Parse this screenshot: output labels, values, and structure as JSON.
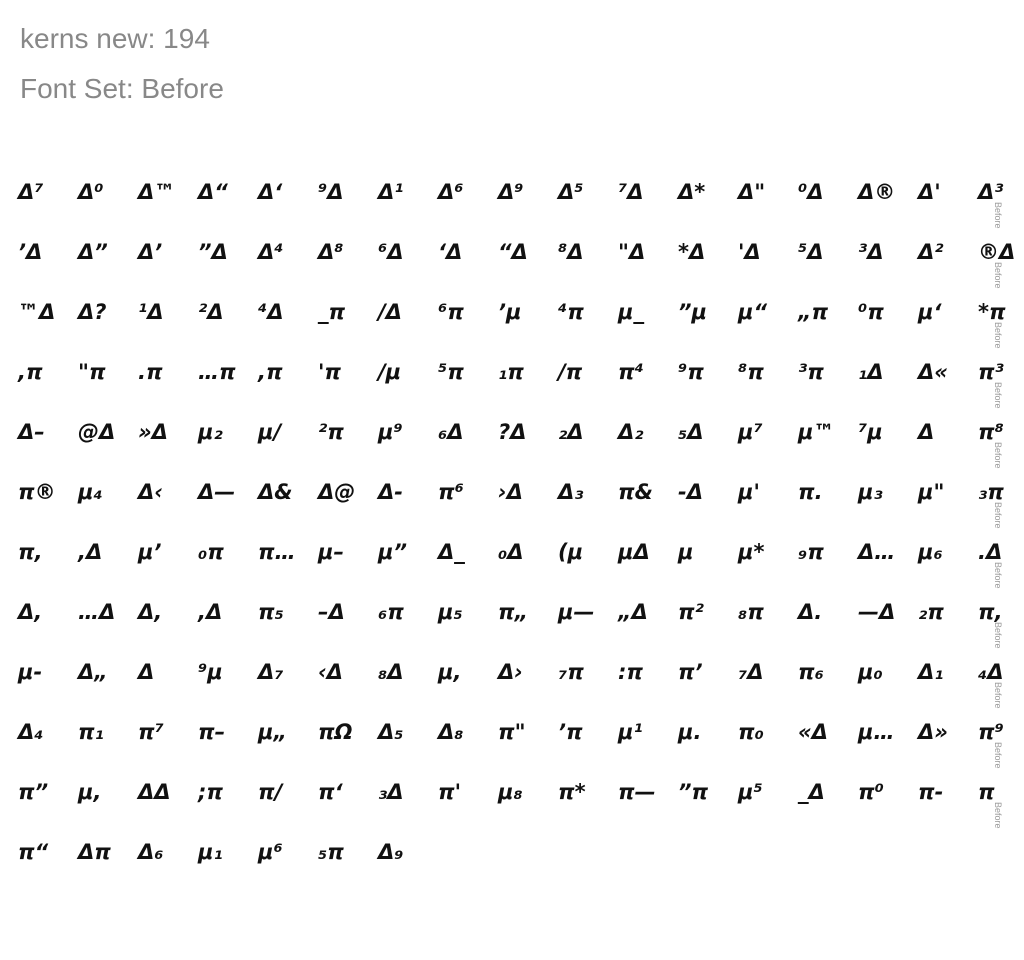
{
  "header": {
    "title": "kerns new: 194",
    "font_set": "Font Set: Before"
  },
  "row_label": "Before",
  "rows": [
    [
      "Δ⁷",
      "Δ⁰",
      "Δ™",
      "Δ“",
      "Δ‘",
      "⁹Δ",
      "Δ¹",
      "Δ⁶",
      "Δ⁹",
      "Δ⁵",
      "⁷Δ",
      "Δ*",
      "Δ\"",
      "⁰Δ",
      "Δ®",
      "Δ'",
      "Δ³"
    ],
    [
      "’Δ",
      "Δ”",
      "Δ’",
      "”Δ",
      "Δ⁴",
      "Δ⁸",
      "⁶Δ",
      "‘Δ",
      "“Δ",
      "⁸Δ",
      "\"Δ",
      "*Δ",
      "'Δ",
      "⁵Δ",
      "³Δ",
      "Δ²",
      "®Δ"
    ],
    [
      "™Δ",
      "Δ?",
      "¹Δ",
      "²Δ",
      "⁴Δ",
      "_π",
      "/Δ",
      "⁶π",
      "’μ",
      "⁴π",
      "μ_",
      "”μ",
      "μ“",
      "„π",
      "⁰π",
      "μ‘",
      "*π"
    ],
    [
      ",π",
      "\"π",
      ".π",
      "…π",
      ",π",
      "'π",
      "/μ",
      "⁵π",
      "₁π",
      "/π",
      "π⁴",
      "⁹π",
      "⁸π",
      "³π",
      "₁Δ",
      "Δ«",
      "π³"
    ],
    [
      "Δ–",
      "@Δ",
      "»Δ",
      "μ₂",
      "μ/",
      "²π",
      "μ⁹",
      "₆Δ",
      "?Δ",
      "₂Δ",
      "Δ₂",
      "₅Δ",
      "μ⁷",
      "μ™",
      "⁷μ",
      "Δ",
      "π⁸"
    ],
    [
      "π®",
      "μ₄",
      "Δ‹",
      "Δ—",
      "Δ&",
      "Δ@",
      "Δ-",
      "π⁶",
      "›Δ",
      "Δ₃",
      "π&",
      "-Δ",
      "μ'",
      "π.",
      "μ₃",
      "μ\"",
      "₃π"
    ],
    [
      "π,",
      ",Δ",
      "μ’",
      "₀π",
      "π…",
      "μ–",
      "μ”",
      "Δ_",
      "₀Δ",
      "(μ",
      "μΔ",
      "μ",
      "μ*",
      "₉π",
      "Δ…",
      "μ₆",
      ".Δ"
    ],
    [
      "Δ,",
      "…Δ",
      "Δ,",
      ",Δ",
      "π₅",
      "–Δ",
      "₆π",
      "μ₅",
      "π„",
      "μ—",
      "„Δ",
      "π²",
      "₈π",
      "Δ.",
      "—Δ",
      "₂π",
      "π,"
    ],
    [
      "μ-",
      "Δ„",
      "Δ",
      "⁹μ",
      "Δ₇",
      "‹Δ",
      "₈Δ",
      "μ,",
      "Δ›",
      "₇π",
      ":π",
      "π’",
      "₇Δ",
      "π₆",
      "μ₀",
      "Δ₁",
      "₄Δ"
    ],
    [
      "Δ₄",
      "π₁",
      "π⁷",
      "π–",
      "μ„",
      "πΩ",
      "Δ₅",
      "Δ₈",
      "π\"",
      "’π",
      "μ¹",
      "μ.",
      "π₀",
      "«Δ",
      "μ…",
      "Δ»",
      "π⁹"
    ],
    [
      "π”",
      "μ,",
      "ΔΔ",
      ";π",
      "π/",
      "π‘",
      "₃Δ",
      "π'",
      "μ₈",
      "π*",
      "π—",
      "”π",
      "μ⁵",
      "_Δ",
      "π⁰",
      "π-",
      "π"
    ],
    [
      "π“",
      "Δπ",
      "Δ₆",
      "μ₁",
      "μ⁶",
      "₅π",
      "Δ₉"
    ]
  ]
}
